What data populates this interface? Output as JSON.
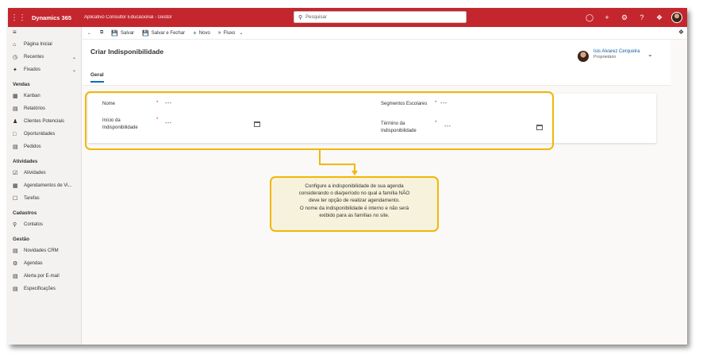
{
  "topbar": {
    "brand": "Dynamics 365",
    "app_name": "Aplicativo Consultor Educacional - Gestor",
    "search_placeholder": "Pesquisar"
  },
  "sidebar": {
    "items_top": [
      {
        "label": "Página Inicial",
        "icon": "home-icon"
      },
      {
        "label": "Recentes",
        "icon": "clock-icon"
      },
      {
        "label": "Fixados",
        "icon": "pin-icon"
      }
    ],
    "groups": [
      {
        "title": "Vendas",
        "items": [
          "Kanban",
          "Relatórios",
          "Clientes Potenciais",
          "Oportunidades",
          "Pedidos"
        ]
      },
      {
        "title": "Atividades",
        "items": [
          "Atividades",
          "Agendamentos de Vi...",
          "Tarefas"
        ]
      },
      {
        "title": "Cadastros",
        "items": [
          "Contatos"
        ]
      },
      {
        "title": "Gestão",
        "items": [
          "Novidades CRM",
          "Agendas",
          "Alerta por E-mail",
          "Especificações"
        ]
      }
    ]
  },
  "commandbar": {
    "save": "Salvar",
    "save_close": "Salvar e Fechar",
    "new": "Novo",
    "flow": "Fluxo"
  },
  "header": {
    "title": "Criar Indisponibilidade",
    "tab": "Geral",
    "owner_name": "Isis Alvarez Cerqueira",
    "owner_role": "Proprietário"
  },
  "form": {
    "nome_label": "Nome",
    "nome_value": "---",
    "segmentos_label": "Segmentos Escolares",
    "segmentos_value": "---",
    "inicio_label_1": "Início da",
    "inicio_label_2": "Indisponibilidade",
    "inicio_value": "---",
    "termino_label_1": "Término da",
    "termino_label_2": "Indisponibilidade",
    "termino_value": "---",
    "required_mark": "*"
  },
  "callout": {
    "line1": "Configure a indisponibilidade de sua agenda",
    "line2": "considerando o dia/período no qual a família NÃO",
    "line3": "deve ter opção de realizar agendamento.",
    "line4": "O nome da indisponibilidade é interno e não será",
    "line5": "exibido para as famílias no site."
  },
  "colors": {
    "topbar": "#c4262e",
    "accent": "#0f6cbd",
    "highlight": "#f2b705",
    "note_bg": "#f6f2dc"
  }
}
